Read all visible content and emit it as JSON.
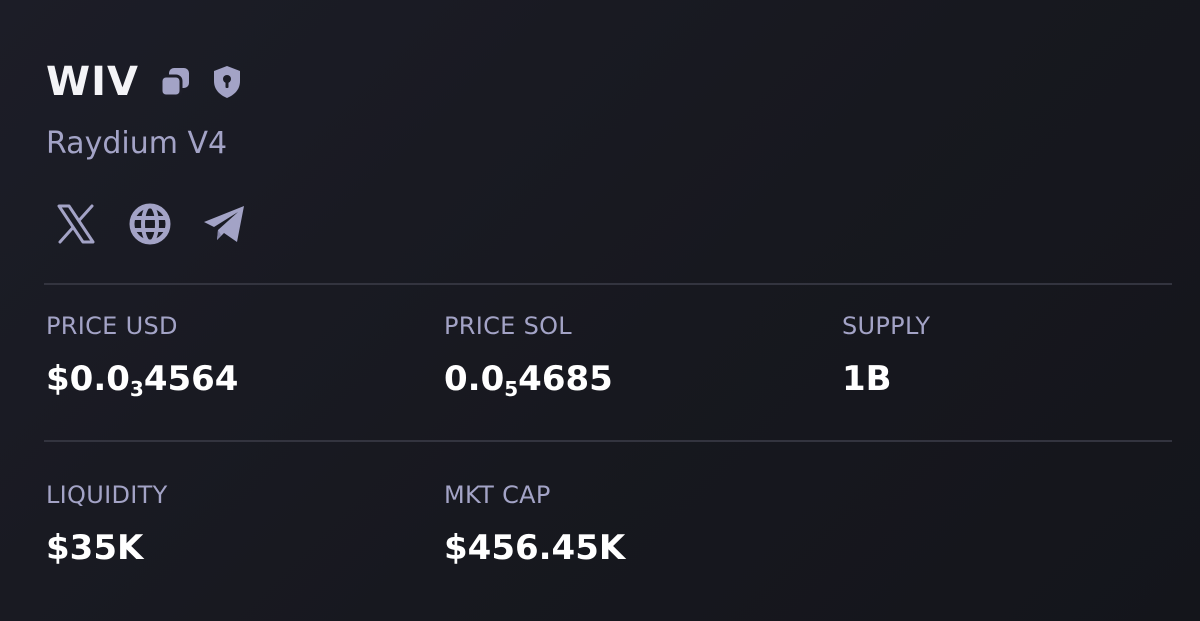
{
  "token": {
    "symbol": "WIV",
    "dex": "Raydium V4"
  },
  "icons": {
    "copy": "copy-icon",
    "shield": "shield-lock-icon",
    "x": "x-twitter-icon",
    "website": "globe-icon",
    "telegram": "telegram-icon",
    "color": "#a3a3c6"
  },
  "stats": {
    "price_usd": {
      "label": "PRICE USD",
      "prefix": "$0.0",
      "zero_count": "3",
      "digits": "4564"
    },
    "price_sol": {
      "label": "PRICE SOL",
      "prefix": "0.0",
      "zero_count": "5",
      "digits": "4685"
    },
    "supply": {
      "label": "SUPPLY",
      "value": "1B"
    },
    "liquidity": {
      "label": "LIQUIDITY",
      "value": "$35K"
    },
    "market_cap": {
      "label": "MKT CAP",
      "value": "$456.45K"
    }
  }
}
